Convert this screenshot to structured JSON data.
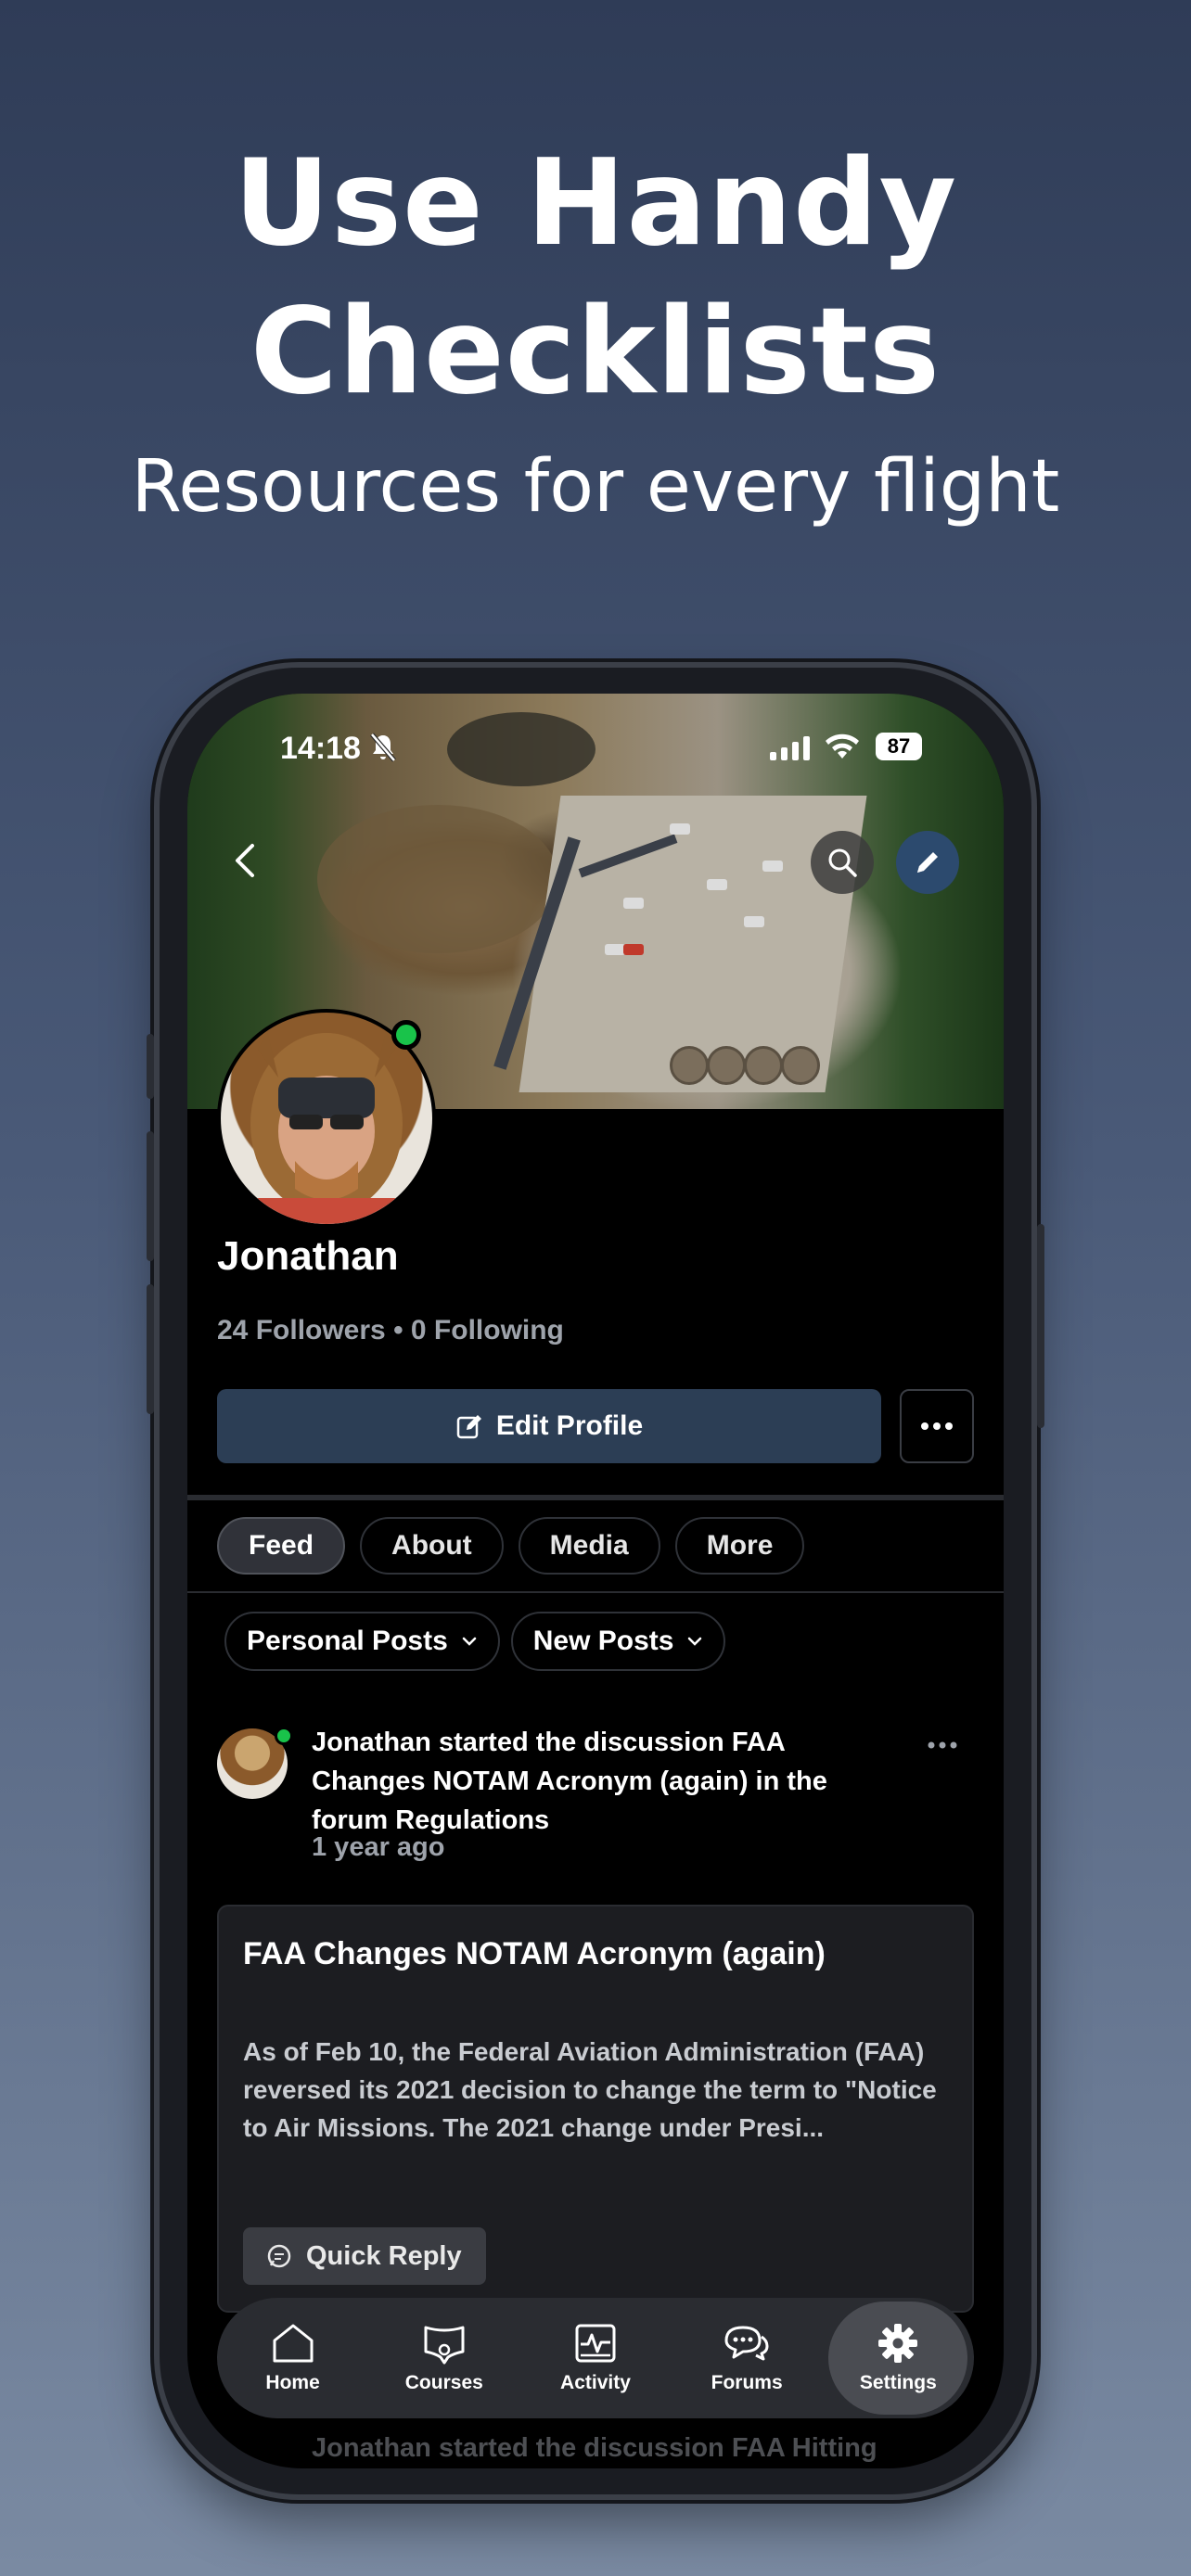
{
  "promo": {
    "headline_line1": "Use Handy",
    "headline_line2": "Checklists",
    "subheadline": "Resources for every flight"
  },
  "status_bar": {
    "time": "14:18",
    "battery": "87"
  },
  "profile": {
    "name": "Jonathan",
    "stats": "24 Followers • 0 Following",
    "edit_label": "Edit Profile"
  },
  "tabs": [
    "Feed",
    "About",
    "Media",
    "More"
  ],
  "active_tab": "Feed",
  "filters": {
    "post_type": "Personal Posts",
    "sort": "New Posts"
  },
  "post": {
    "text": "Jonathan started the discussion FAA Changes NOTAM Acronym (again) in the forum Regulations",
    "time": "1 year ago",
    "card_title": "FAA Changes NOTAM Acronym (again)",
    "card_body": "As of Feb 10, the Federal Aviation Administration (FAA) reversed its 2021 decision to change the term to \"Notice to Air Missions. The 2021 change under Presi...",
    "quick_reply_label": "Quick Reply"
  },
  "next_post_preview": "Jonathan started the discussion FAA Hitting",
  "tab_bar": {
    "items": [
      {
        "label": "Home",
        "icon": "home-icon"
      },
      {
        "label": "Courses",
        "icon": "courses-icon"
      },
      {
        "label": "Activity",
        "icon": "activity-icon"
      },
      {
        "label": "Forums",
        "icon": "forums-icon"
      },
      {
        "label": "Settings",
        "icon": "settings-icon"
      }
    ],
    "active": "Settings"
  },
  "colors": {
    "online": "#19c34a",
    "edit_button": "#2c3e55",
    "edit_fab": "#2c4a6e"
  }
}
